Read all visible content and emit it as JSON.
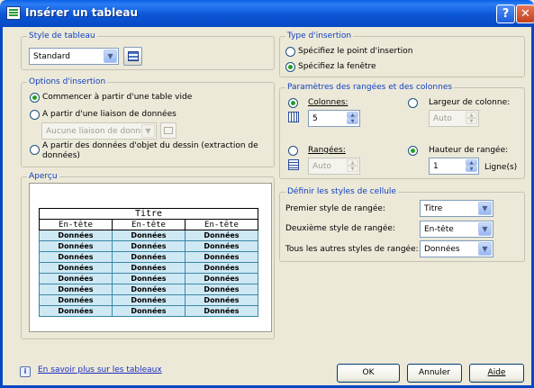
{
  "window": {
    "title": "Insérer un tableau",
    "help_glyph": "?",
    "close_glyph": "✕"
  },
  "style": {
    "group_title": "Style de tableau",
    "selected": "Standard"
  },
  "options": {
    "group_title": "Options d'insertion",
    "opt1": "Commencer à partir d'une table vide",
    "opt2": "A partir d'une liaison de données",
    "opt2_combo": "Aucune liaison de donné",
    "opt3_line1": "A partir des données d'objet du dessin (extraction de",
    "opt3_line2": "données)"
  },
  "preview": {
    "group_title": "Aperçu",
    "title": "Titre",
    "headers": [
      "En-tête",
      "En-tête",
      "En-tête"
    ],
    "data_text": "Données",
    "data_rows": 8
  },
  "insertion": {
    "group_title": "Type d'insertion",
    "opt1": "Spécifiez le point d'insertion",
    "opt2": "Spécifiez la fenêtre"
  },
  "params": {
    "group_title": "Paramètres des rangées et des colonnes",
    "colonnes_label": "Colonnes:",
    "colonnes_value": "5",
    "largeur_label": "Largeur de colonne:",
    "largeur_value": "Auto",
    "rangees_label": "Rangées:",
    "rangees_value": "Auto",
    "hauteur_label": "Hauteur de rangée:",
    "hauteur_value": "1",
    "lignes_label": "Ligne(s)"
  },
  "cellstyles": {
    "group_title": "Définir les styles de cellule",
    "first_label": "Premier style de rangée:",
    "first_value": "Titre",
    "second_label": "Deuxième style de rangée:",
    "second_value": "En-tête",
    "others_label": "Tous les autres styles de rangée:",
    "others_value": "Données"
  },
  "footer": {
    "link": "En savoir plus sur les tableaux",
    "ok": "OK",
    "cancel": "Annuler",
    "help": "Aide"
  }
}
